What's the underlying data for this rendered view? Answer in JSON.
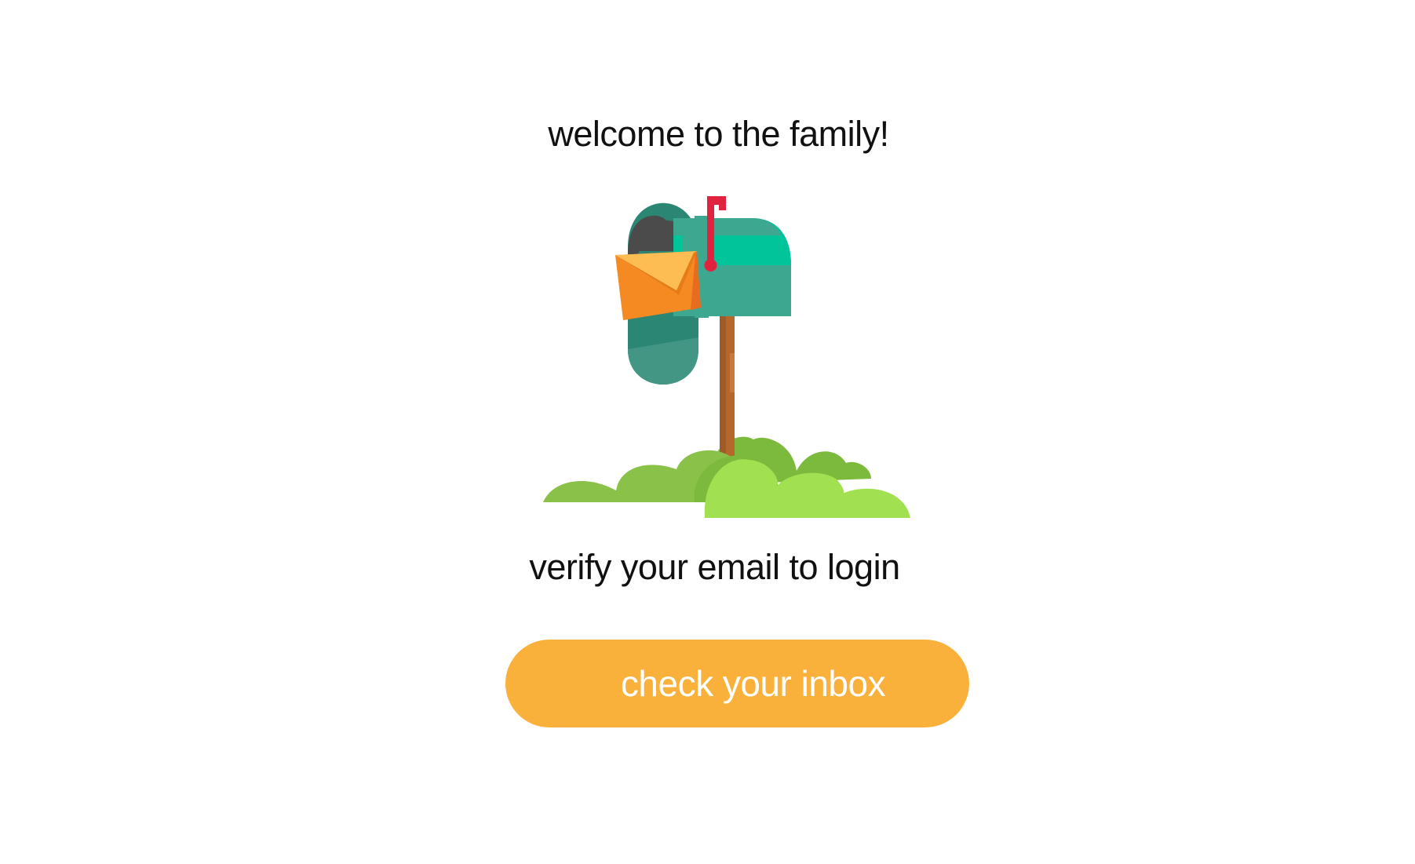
{
  "welcome": {
    "title": "welcome to the family!",
    "subtitle": "verify your email to login"
  },
  "illustration": {
    "icon": "mailbox-illustration",
    "colors": {
      "mailbox": "#3da88f",
      "mailbox_top": "#00c49a",
      "mailbox_door": "#2c8674",
      "door_shade": "#4b4b4b",
      "flag": "#e2233f",
      "post": "#b5672c",
      "envelope": "#f68a22",
      "envelope_flap": "#fdbd53",
      "bush_dark": "#7cba3e",
      "bush_light": "#a1e050"
    }
  },
  "actions": {
    "check_inbox_label": "check your inbox",
    "button_color": "#f9b13c"
  }
}
